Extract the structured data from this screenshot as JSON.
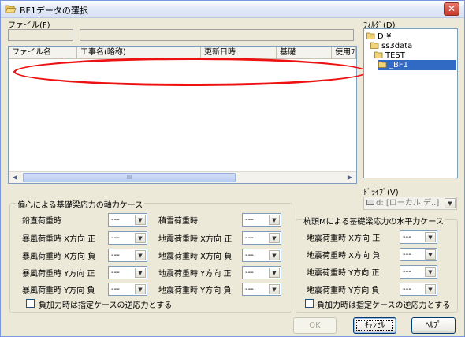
{
  "window": {
    "title": "BF1データの選択"
  },
  "file": {
    "label": "ファイル(F)"
  },
  "file_list": {
    "columns": [
      "ファイル名",
      "工事名(略称)",
      "更新日時",
      "基礎",
      "使用ﾌ"
    ],
    "scroll_thumb": "III"
  },
  "folder": {
    "label": "ﾌｫﾙﾀﾞ(D)",
    "items": [
      "D:¥",
      "ss3data",
      "TEST",
      "_BF1"
    ],
    "selected": "_BF1"
  },
  "drive": {
    "label": "ﾄﾞﾗｲﾌﾞ(V)",
    "value": "d: [ローカル デ..]"
  },
  "axial": {
    "title": "偏心による基礎梁応力の軸力ケース",
    "left_rows": [
      {
        "label": "鉛直荷重時",
        "value": "---"
      },
      {
        "label": "暴風荷重時 X方向 正",
        "value": "---"
      },
      {
        "label": "暴風荷重時 X方向 負",
        "value": "---"
      },
      {
        "label": "暴風荷重時 Y方向 正",
        "value": "---"
      },
      {
        "label": "暴風荷重時 Y方向 負",
        "value": "---"
      }
    ],
    "right_rows": [
      {
        "label": "積雪荷重時",
        "value": "---"
      },
      {
        "label": "地震荷重時 X方向 正",
        "value": "---"
      },
      {
        "label": "地震荷重時 X方向 負",
        "value": "---"
      },
      {
        "label": "地震荷重時 Y方向 正",
        "value": "---"
      },
      {
        "label": "地震荷重時 Y方向 負",
        "value": "---"
      }
    ],
    "reverse_label": "負加力時は指定ケースの逆応力とする"
  },
  "horizontal": {
    "title": "杭頭Mによる基礎梁応力の水平力ケース",
    "rows": [
      {
        "label": "地震荷重時 X方向 正",
        "value": "---"
      },
      {
        "label": "地震荷重時 X方向 負",
        "value": "---"
      },
      {
        "label": "地震荷重時 Y方向 正",
        "value": "---"
      },
      {
        "label": "地震荷重時 Y方向 負",
        "value": "---"
      }
    ],
    "reverse_label": "負加力時は指定ケースの逆応力とする"
  },
  "buttons": {
    "ok": "OK",
    "cancel": "ｷｬﾝｾﾙ",
    "help": "ﾍﾙﾌﾟ"
  },
  "colors": {
    "annotation": "#ee1111",
    "selection": "#316ac5"
  }
}
